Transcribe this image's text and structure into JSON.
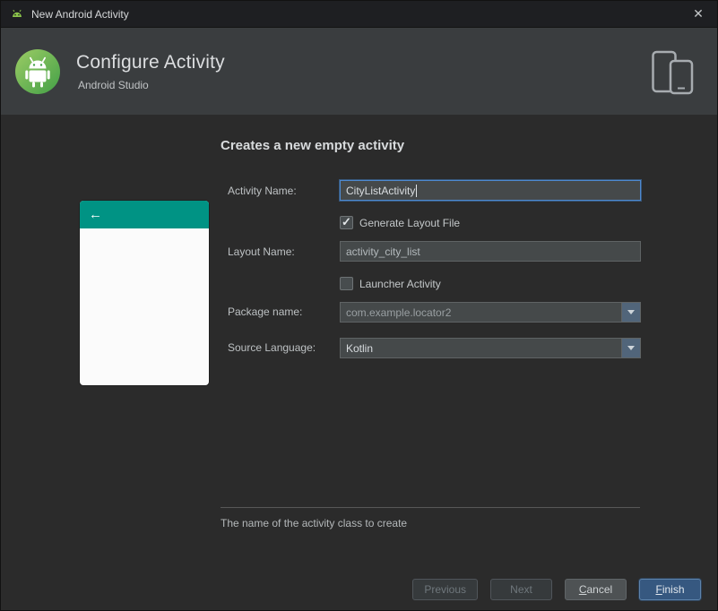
{
  "window": {
    "title": "New Android Activity",
    "close_glyph": "✕"
  },
  "header": {
    "title": "Configure Activity",
    "subtitle": "Android Studio"
  },
  "preview": {
    "back_arrow": "←"
  },
  "main": {
    "heading": "Creates a new empty activity",
    "fields": {
      "activity_name": {
        "label": "Activity Name:",
        "value": "CityListActivity"
      },
      "generate_layout": {
        "label": "Generate Layout File",
        "checked": true
      },
      "layout_name": {
        "label": "Layout Name:",
        "value": "activity_city_list"
      },
      "launcher": {
        "label": "Launcher Activity",
        "checked": false
      },
      "package_name": {
        "label": "Package name:",
        "value": "com.example.locator2"
      },
      "source_language": {
        "label": "Source Language:",
        "value": "Kotlin"
      }
    },
    "hint": "The name of the activity class to create"
  },
  "footer": {
    "previous": "Previous",
    "next": "Next",
    "cancel": {
      "mnemonic": "C",
      "rest": "ancel"
    },
    "finish": {
      "mnemonic": "F",
      "rest": "inish"
    }
  },
  "icons": {
    "titlebar": "android-logo-icon",
    "banner": "android-studio-logo-icon",
    "devices": "phone-tablet-icon",
    "combo": "chevron-down-icon",
    "preview": "back-arrow-icon",
    "close": "close-icon"
  },
  "colors": {
    "appbar_teal": "#009384",
    "focus_blue": "#4e8ad1",
    "finish_blue": "#365880",
    "banner_gray": "#3a3d3f",
    "body_gray": "#2b2b2b"
  }
}
